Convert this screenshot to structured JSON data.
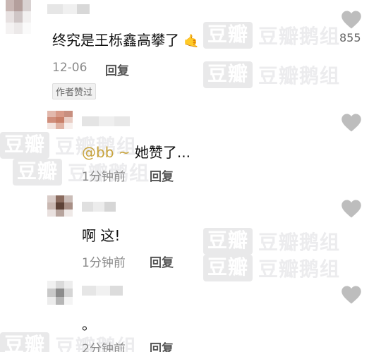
{
  "watermark": {
    "box": "豆瓣",
    "text": "豆瓣鹅组"
  },
  "comments": [
    {
      "text": "终究是王栎鑫高攀了",
      "emoji": "🤙",
      "date": "12-06",
      "reply": "回复",
      "tag": "作者赞过",
      "likes": "855"
    },
    {
      "mention": "@bb ~",
      "text": "她赞了...",
      "time": "1分钟前",
      "reply": "回复"
    },
    {
      "text": "啊 这!",
      "time": "1分钟前",
      "reply": "回复"
    },
    {
      "text": "。",
      "time": "2分钟前",
      "reply": "回复"
    }
  ]
}
